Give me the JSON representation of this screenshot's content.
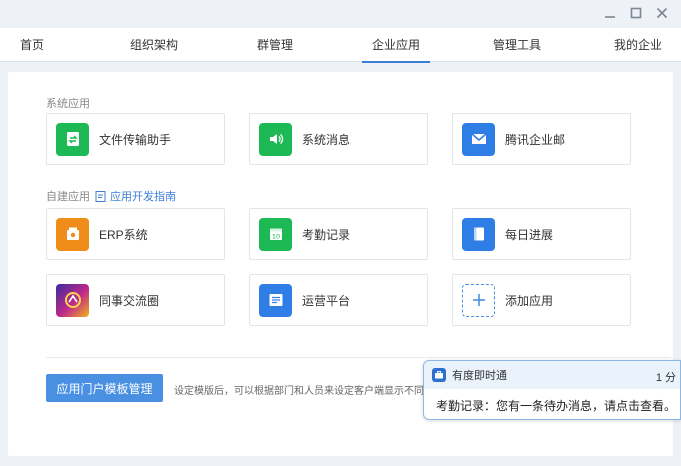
{
  "tabs": [
    {
      "label": "首页"
    },
    {
      "label": "组织架构"
    },
    {
      "label": "群管理"
    },
    {
      "label": "企业应用"
    },
    {
      "label": "管理工具"
    },
    {
      "label": "我的企业"
    }
  ],
  "active_tab": "企业应用",
  "system_apps": {
    "label": "系统应用",
    "items": [
      {
        "label": "文件传输助手",
        "icon": "file-transfer-icon",
        "color": "#1db954"
      },
      {
        "label": "系统消息",
        "icon": "speaker-icon",
        "color": "#1db954"
      },
      {
        "label": "腾讯企业邮",
        "icon": "mail-icon",
        "color": "#2e7ee6"
      }
    ]
  },
  "custom_apps": {
    "label": "自建应用",
    "guide_link": "应用开发指南",
    "items": [
      {
        "label": "ERP系统",
        "icon": "erp-icon",
        "color": "#f08c1a"
      },
      {
        "label": "考勤记录",
        "icon": "calendar-icon",
        "color": "#1db954"
      },
      {
        "label": "每日进展",
        "icon": "notebook-icon",
        "color": "#2e7ee6"
      },
      {
        "label": "同事交流圈",
        "icon": "colleague-circle-icon",
        "color": "#7a3fd0"
      },
      {
        "label": "运营平台",
        "icon": "operations-icon",
        "color": "#2e7ee6"
      },
      {
        "label": "添加应用",
        "icon": "plus-icon",
        "color": "#4a90e2"
      }
    ]
  },
  "portal": {
    "button_label": "应用门户模板管理",
    "description": "设定模版后，可以根据部门和人员来设定客户端显示不同的"
  },
  "notification": {
    "app_name": "有度即时通",
    "time": "1 分",
    "message": "考勤记录：您有一条待办消息，请点击查看。"
  }
}
